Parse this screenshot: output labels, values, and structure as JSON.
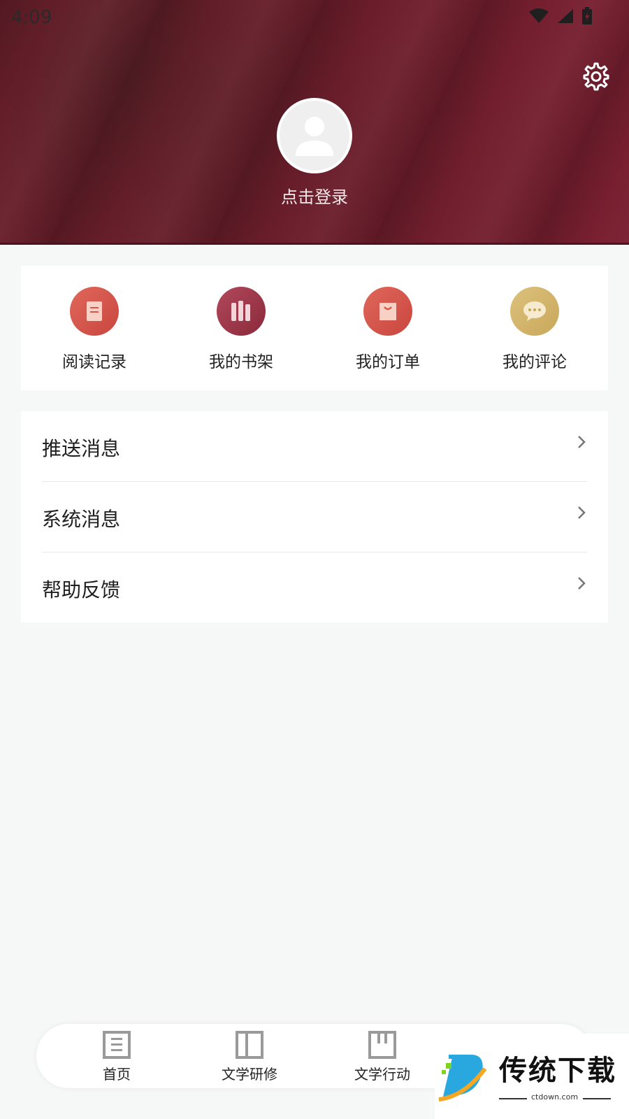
{
  "status": {
    "time": "4:09"
  },
  "profile": {
    "login_prompt": "点击登录"
  },
  "quick_actions": [
    {
      "label": "阅读记录",
      "icon": "document-icon",
      "color": "#d9574a"
    },
    {
      "label": "我的书架",
      "icon": "books-icon",
      "color": "#9e3447"
    },
    {
      "label": "我的订单",
      "icon": "shopping-bag-icon",
      "color": "#d9574a"
    },
    {
      "label": "我的评论",
      "icon": "chat-bubble-icon",
      "color": "#d2b36a"
    }
  ],
  "menu": [
    {
      "label": "推送消息"
    },
    {
      "label": "系统消息"
    },
    {
      "label": "帮助反馈"
    }
  ],
  "tabs": [
    {
      "label": "首页",
      "icon": "home-doc-icon"
    },
    {
      "label": "文学研修",
      "icon": "book-columns-icon"
    },
    {
      "label": "文学行动",
      "icon": "action-box-icon"
    }
  ],
  "watermark": {
    "title": "传统下载",
    "subtitle": "ctdown.com"
  },
  "theme": {
    "header": "#6b1d2b",
    "accent": "#9e3447",
    "background": "#f6f7f7"
  }
}
